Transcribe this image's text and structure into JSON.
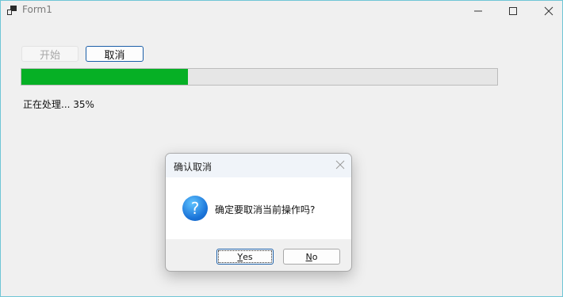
{
  "window": {
    "title": "Form1",
    "icon": "app-icon",
    "controls": [
      "minimize-icon",
      "maximize-icon",
      "close-icon"
    ]
  },
  "form": {
    "start_button": {
      "label": "开始",
      "enabled": false
    },
    "cancel_button": {
      "label": "取消",
      "enabled": true
    },
    "progress": {
      "percent": 35,
      "color": "#06b025"
    },
    "status_text": "正在处理... 35%"
  },
  "dialog": {
    "title": "确认取消",
    "icon": "question-icon",
    "message": "确定要取消当前操作吗?",
    "yes_button": {
      "mnemonic": "Y",
      "rest": "es"
    },
    "no_button": {
      "mnemonic": "N",
      "rest": "o"
    }
  }
}
